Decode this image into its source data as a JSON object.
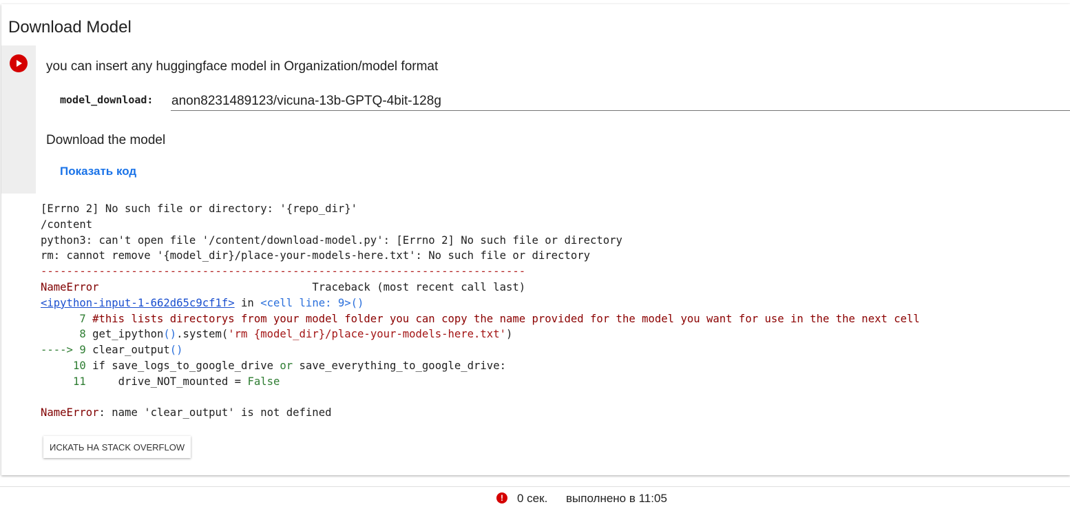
{
  "cell": {
    "title": "Download Model",
    "description": "you can insert any huggingface model in Organization/model format",
    "field_label": "model_download:",
    "field_value": "anon8231489123/vicuna-13b-GPTQ-4bit-128g",
    "section_text": "Download the model",
    "show_code": "Показать код"
  },
  "output": {
    "line1": "[Errno 2] No such file or directory: '{repo_dir}'",
    "line2": "/content",
    "line3": "python3: can't open file '/content/download-model.py': [Errno 2] No such file or directory",
    "line4": "rm: cannot remove '{model_dir}/place-your-models-here.txt': No such file or directory",
    "separator": "---------------------------------------------------------------------------",
    "error_name": "NameError",
    "traceback_label": "Traceback (most recent call last)",
    "ipython_link": "<ipython-input-1-662d65c9cf1f>",
    "in_text": " in ",
    "cell_line": "<cell line: 9>()",
    "l7_num": "      7 ",
    "l7_code": "#this lists directorys from your model folder you can copy the name provided for the model you want for use in the the next cell",
    "l8_num": "      8 ",
    "l8_code_a": "get_ipython",
    "l8_code_b": "()",
    "l8_code_c": ".system(",
    "l8_code_d": "'rm {model_dir}/place-your-models-here.txt'",
    "l8_code_e": ")",
    "l9_arrow": "----> 9 ",
    "l9_code_a": "clear_output",
    "l9_code_b": "()",
    "l10_num": "     10 ",
    "l10_code_a": "if save_logs_to_google_drive ",
    "l10_code_b": "or",
    "l10_code_c": " save_everything_to_google_drive:",
    "l11_num": "     11 ",
    "l11_code_a": "    drive_NOT_mounted = ",
    "l11_code_b": "False",
    "final_error_name": "NameError",
    "final_error_msg": ": name 'clear_output' is not defined"
  },
  "so_button": "ИСКАТЬ НА STACK OVERFLOW",
  "status": {
    "time": "0 сек.",
    "done": "выполнено в 11:05"
  },
  "icons": {
    "run": "play-icon",
    "status": "error-icon"
  },
  "colors": {
    "error_red": "#d50000",
    "link_blue": "#1a73e8"
  }
}
